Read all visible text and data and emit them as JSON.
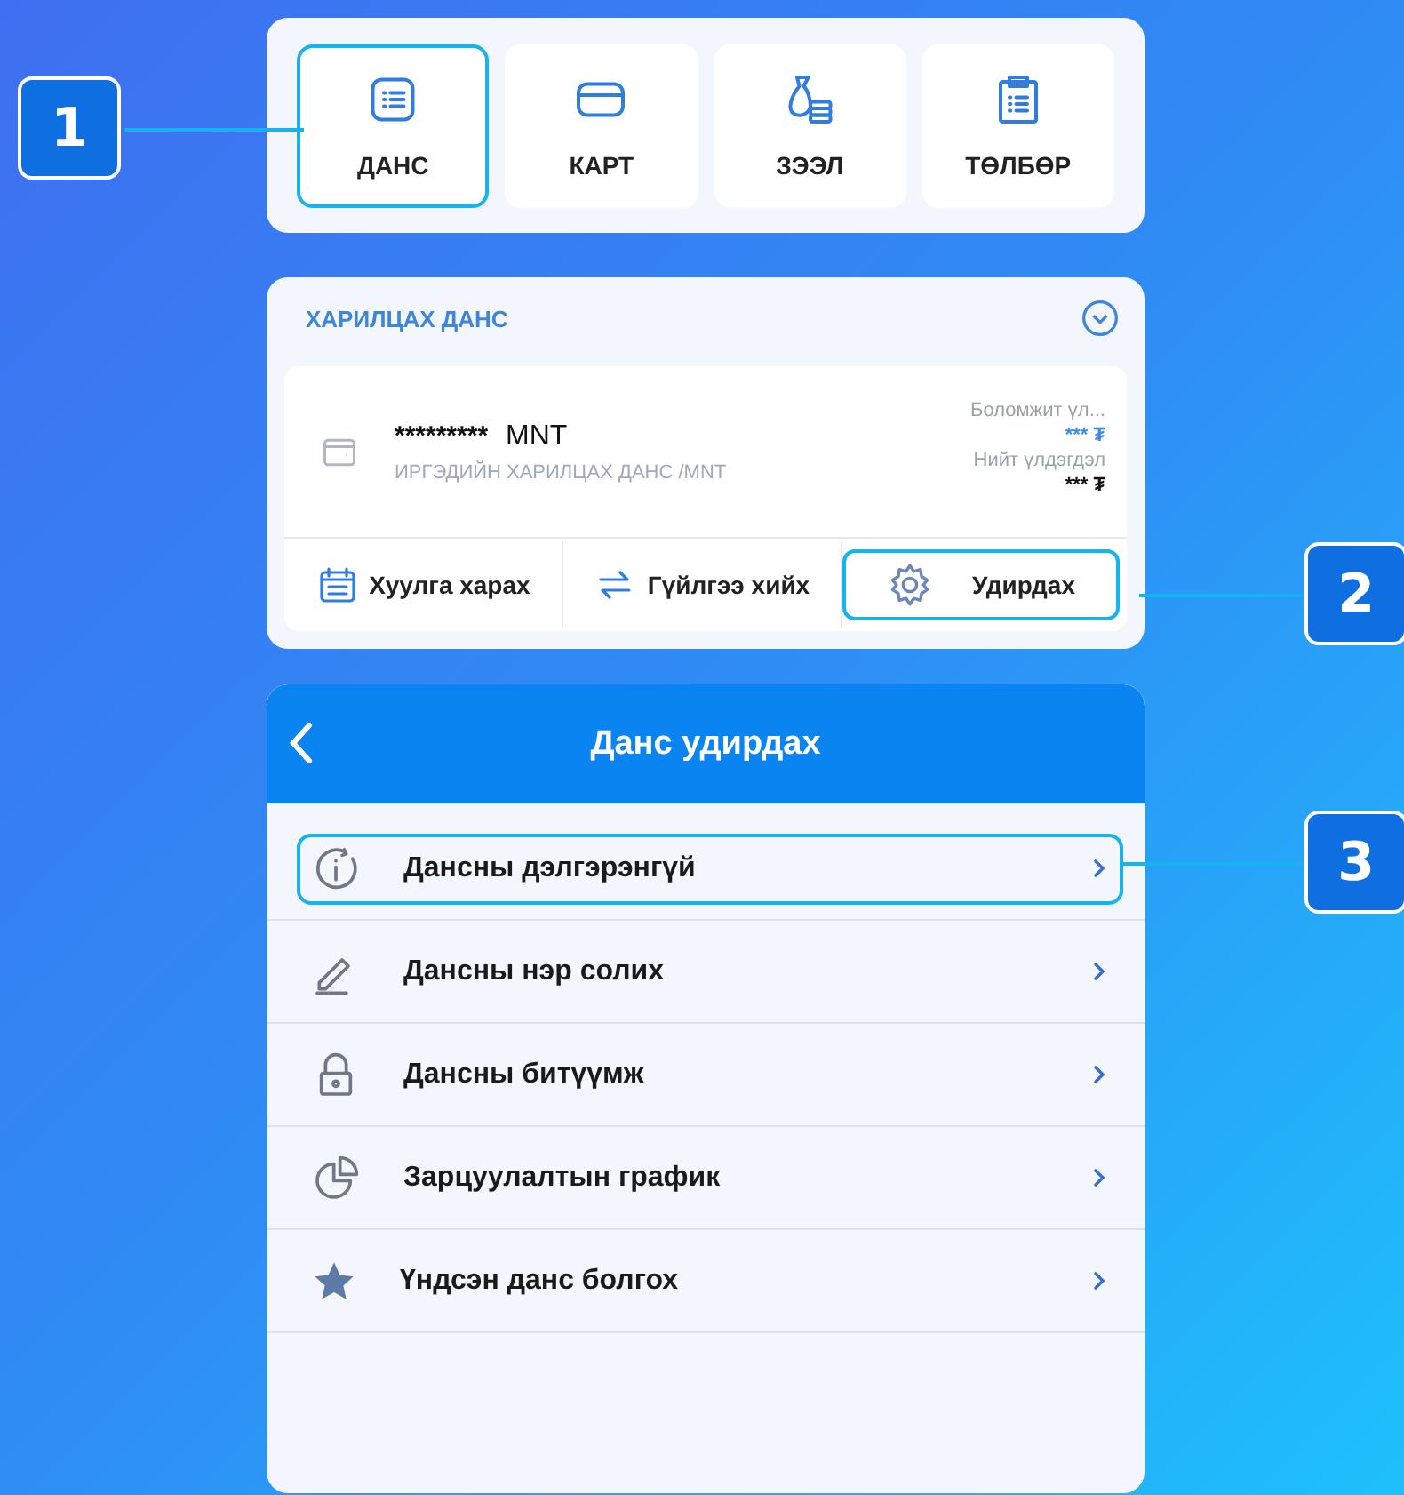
{
  "tiles": [
    {
      "label": "ДАНС",
      "kind": "list",
      "highlighted": true
    },
    {
      "label": "КАРТ",
      "kind": "card",
      "highlighted": false
    },
    {
      "label": "ЗЭЭЛ",
      "kind": "loan",
      "highlighted": false
    },
    {
      "label": "ТӨЛБӨР",
      "kind": "clipboard",
      "highlighted": false
    }
  ],
  "account_panel": {
    "title": "ХАРИЛЦАХ ДАНС",
    "number": "*********",
    "currency": "MNT",
    "type": "ИРГЭДИЙН ХАРИЛЦАХ ДАНС /MNT",
    "available_label": "Боломжит үл...",
    "available_value": "*** ₮",
    "total_label": "Нийт үлдэгдэл",
    "total_value": "*** ₮",
    "actions": [
      {
        "label": "Хуулга харах",
        "kind": "calendar",
        "highlighted": false
      },
      {
        "label": "Гүйлгээ хийх",
        "kind": "transfer",
        "highlighted": false
      },
      {
        "label": "Удирдах",
        "kind": "gear",
        "highlighted": true
      }
    ]
  },
  "manage_screen": {
    "title": "Данс удирдах",
    "items": [
      {
        "label": "Дансны дэлгэрэнгүй",
        "kind": "info",
        "highlighted": true
      },
      {
        "label": "Дансны нэр солих",
        "kind": "pencil",
        "highlighted": false
      },
      {
        "label": "Дансны битүүмж",
        "kind": "lock",
        "highlighted": false
      },
      {
        "label": "Зарцуулалтын график",
        "kind": "pie",
        "highlighted": false
      },
      {
        "label": "Үндсэн данс болгох",
        "kind": "star",
        "highlighted": false
      }
    ]
  },
  "callouts": [
    {
      "number": "1"
    },
    {
      "number": "2"
    },
    {
      "number": "3"
    }
  ]
}
